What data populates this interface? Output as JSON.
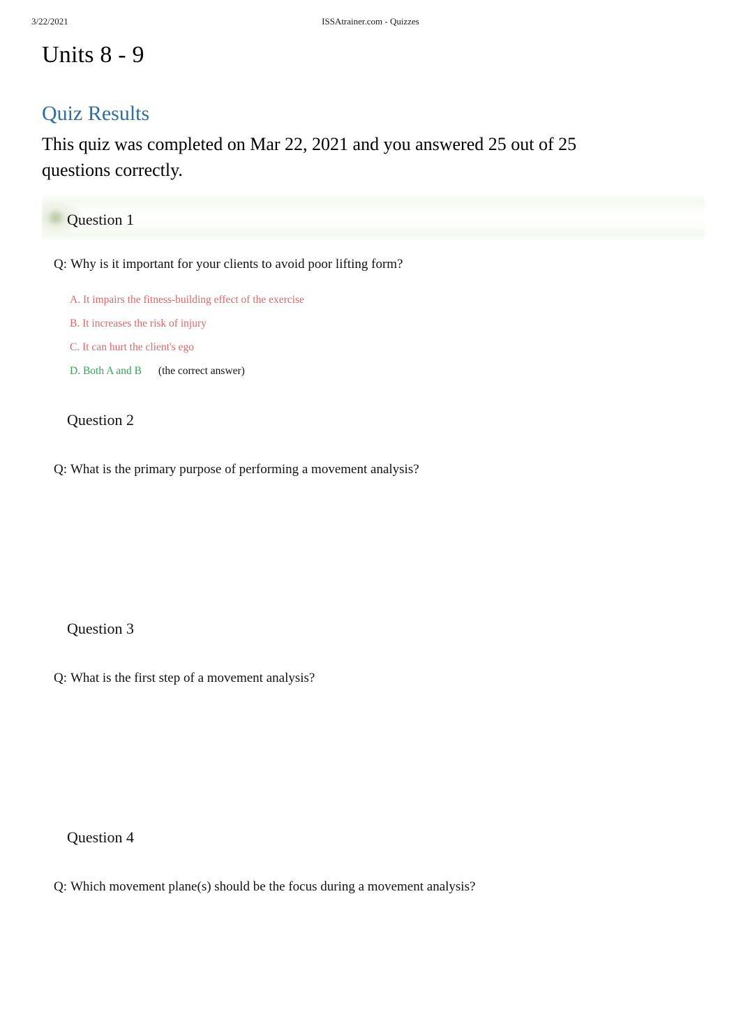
{
  "print_header": {
    "date": "3/22/2021",
    "site_title": "ISSAtrainer.com - Quizzes"
  },
  "page_title": "Units 8 - 9",
  "results": {
    "heading": "Quiz Results",
    "heading_color": "#2b6ea3",
    "summary": "This quiz was completed on Mar 22, 2021 and you answered 25 out of 25 questions correctly.",
    "completed_date": "Mar 22, 2021",
    "answered_correct": "25",
    "total_questions": "25"
  },
  "colors": {
    "heading_blue": "#2b6ea3",
    "incorrect_red": "#e06464",
    "correct_green": "#2aa94e",
    "band_green_tint": "#f3f8f0",
    "text_black": "#111111"
  },
  "questions": [
    {
      "label": "Question 1",
      "q_prefix": "Q:",
      "text": "Why is it important for your clients to avoid poor lifting form?",
      "highlighted": true,
      "answers": [
        {
          "text": "A. It impairs the fitness-building effect of the exercise",
          "state": "incorrect",
          "note": ""
        },
        {
          "text": "B. It increases the risk of injury",
          "state": "incorrect",
          "note": ""
        },
        {
          "text": "C. It can hurt the client's ego",
          "state": "incorrect",
          "note": ""
        },
        {
          "text": "D. Both A and B",
          "state": "correct",
          "note": "(the correct answer)"
        }
      ]
    },
    {
      "label": "Question 2",
      "q_prefix": "Q:",
      "text": "What is the primary purpose of performing a movement analysis?",
      "highlighted": false,
      "answers": []
    },
    {
      "label": "Question 3",
      "q_prefix": "Q:",
      "text": "What is the first step of a movement analysis?",
      "highlighted": false,
      "answers": []
    },
    {
      "label": "Question 4",
      "q_prefix": "Q:",
      "text": "Which movement plane(s) should be the focus during a movement analysis?",
      "highlighted": false,
      "answers": []
    }
  ]
}
